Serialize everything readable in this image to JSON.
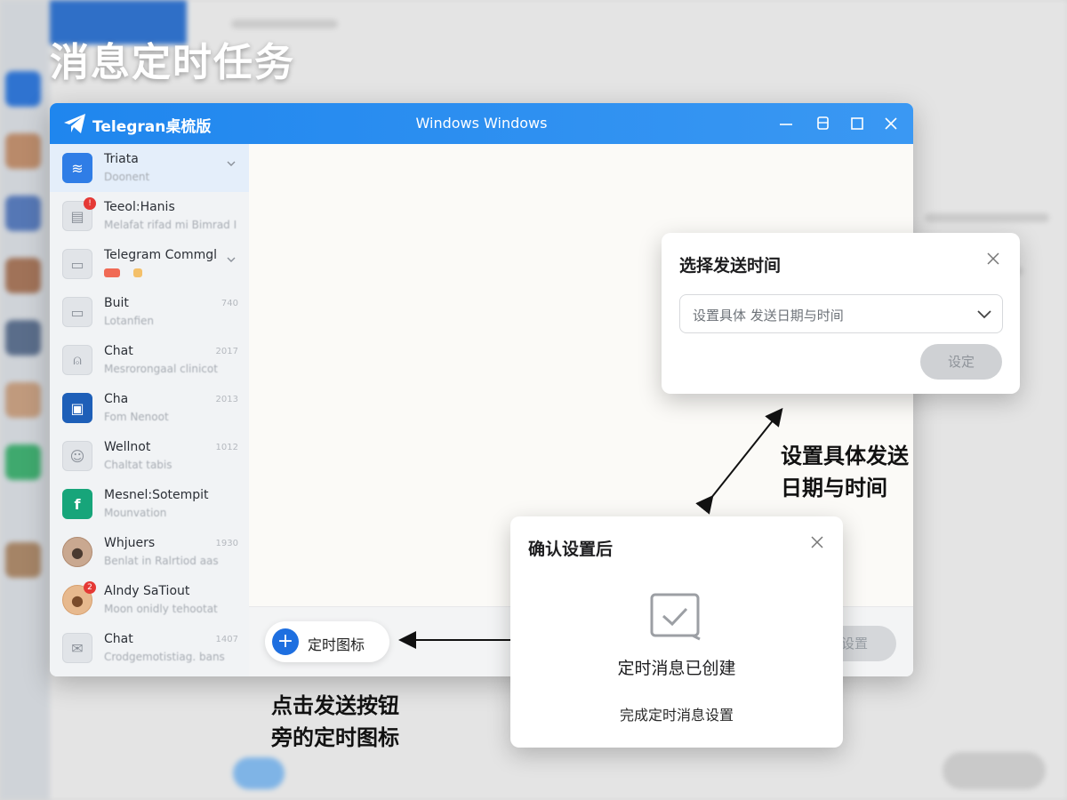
{
  "headline": "消息定时任务",
  "window": {
    "app_title": "Telegran桌梳版",
    "title": "Windows Windows",
    "controls": [
      "minimize-icon",
      "restore-icon",
      "maximize-icon",
      "close-icon"
    ]
  },
  "chats": [
    {
      "name": "Triata",
      "preview": "Doonent",
      "time": "",
      "unread": ""
    },
    {
      "name": "Teeol:Hanis",
      "preview": "Melafat rifad mi Bimrad I",
      "time": "",
      "unread": "!"
    },
    {
      "name": "Telegram Commgl",
      "preview": "",
      "time": "",
      "unread": ""
    },
    {
      "name": "Buit",
      "preview": "Lotanfien",
      "time": "740",
      "unread": ""
    },
    {
      "name": "Chat",
      "preview": "Mesrorongaal clinicot",
      "time": "2017",
      "unread": ""
    },
    {
      "name": "Cha",
      "preview": "Fom Nenoot",
      "time": "2013",
      "unread": ""
    },
    {
      "name": "Wellnot",
      "preview": "Chaltat tabis",
      "time": "1012",
      "unread": ""
    },
    {
      "name": "Mesnel:Sotempit",
      "preview": "Mounvation",
      "time": "",
      "unread": ""
    },
    {
      "name": "Whjuers",
      "preview": "Benlat in Ralrtiod aas",
      "time": "1930",
      "unread": ""
    },
    {
      "name": "Alndy SaTiout",
      "preview": "Moon onidly tehootat",
      "time": "",
      "unread": "2"
    },
    {
      "name": "Chat",
      "preview": "Crodgemotistiag. bans",
      "time": "1407",
      "unread": ""
    }
  ],
  "composer": {
    "schedule_label": "定时图标",
    "ghost_button": "设置"
  },
  "dialog_time": {
    "title": "选择发送时间",
    "select_placeholder": "设置具体 发送日期与时间",
    "button": "设定"
  },
  "dialog_confirm": {
    "title": "确认设置后",
    "message": "定时消息已创建",
    "sub": "完成定时消息设置"
  },
  "annotations": {
    "time_note_line1": "设置具体发送",
    "time_note_line2": "日期与时间",
    "click_note_line1": "点击发送按钮",
    "click_note_line2": "旁的定时图标"
  },
  "colors": {
    "titlebar": "#1f86ee",
    "accent": "#1e6fe0",
    "unread": "#e53935"
  }
}
